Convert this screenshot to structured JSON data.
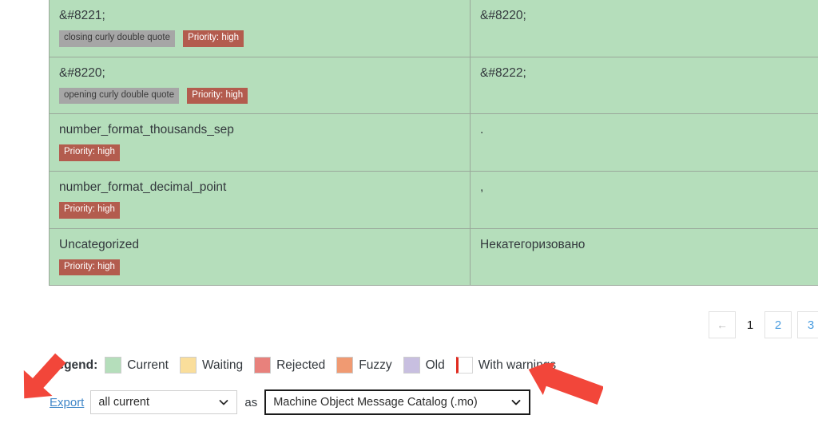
{
  "table": {
    "rows": [
      {
        "source": "&#8221;",
        "tag": "closing curly double quote",
        "priority": "Priority: high",
        "translation": "&#8220;"
      },
      {
        "source": "&#8220;",
        "tag": "opening curly double quote",
        "priority": "Priority: high",
        "translation": "&#8222;"
      },
      {
        "source": "number_format_thousands_sep",
        "tag": "",
        "priority": "Priority: high",
        "translation": "."
      },
      {
        "source": "number_format_decimal_point",
        "tag": "",
        "priority": "Priority: high",
        "translation": ","
      },
      {
        "source": "Uncategorized",
        "tag": "",
        "priority": "Priority: high",
        "translation": "Некатегоризовано"
      }
    ]
  },
  "pagination": {
    "prev_label": "←",
    "current_page": "1",
    "page_2": "2",
    "page_3": "3"
  },
  "legend": {
    "title": "Legend:",
    "items": [
      {
        "label": "Current",
        "color": "#b5debb"
      },
      {
        "label": "Waiting",
        "color": "#fade9b"
      },
      {
        "label": "Rejected",
        "color": "#e8817c"
      },
      {
        "label": "Fuzzy",
        "color": "#f09a72"
      },
      {
        "label": "Old",
        "color": "#c8bfe0"
      },
      {
        "label": "With warnings",
        "color": "#ffffff"
      }
    ]
  },
  "export": {
    "link_label": "Export",
    "scope_value": "all current",
    "as_label": "as",
    "format_value": "Machine Object Message Catalog (.mo)"
  },
  "annotations": {
    "arrow_color": "#f2463a",
    "arrow_1_target": "Export",
    "arrow_2_target": "format-select"
  }
}
